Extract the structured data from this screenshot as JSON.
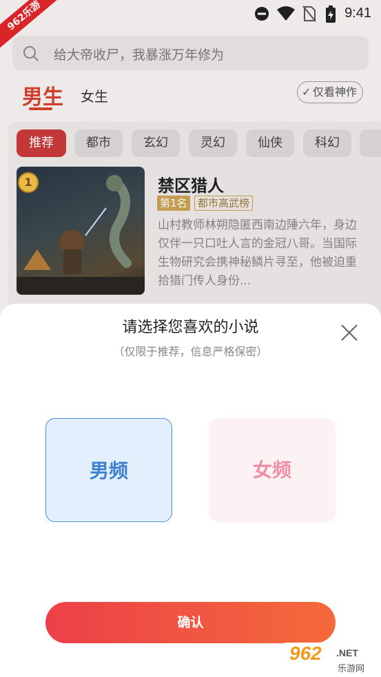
{
  "status_bar": {
    "time": "9:41"
  },
  "corner_watermark": "962乐游",
  "search": {
    "placeholder": "给大帝收尸，我暴涨万年修为"
  },
  "gender_tabs": {
    "male": "男生",
    "female": "女生",
    "only_good_label": "仅看神作"
  },
  "categories": [
    "推荐",
    "都市",
    "玄幻",
    "灵幻",
    "仙侠",
    "科幻"
  ],
  "book": {
    "title": "禁区猎人",
    "rank_number": "1",
    "rank_tag": "第1名",
    "list_tag": "都市高武榜",
    "description": "山村教师林朔隐匿西南边陲六年，身边仅伴一只口吐人言的金冠八哥。当国际生物研究会携神秘鳞片寻至，他被迫重拾猎门传人身份..."
  },
  "sheet": {
    "title": "请选择您喜欢的小说",
    "subtitle": "（仅限于推荐，信息严格保密）",
    "male_option": "男频",
    "female_option": "女频",
    "confirm_label": "确认"
  },
  "bottom_watermark": {
    "number": "962",
    "net": ".NET",
    "sub": "乐游网"
  },
  "colors": {
    "accent": "#d7402f",
    "male_blue": "#3b7fd0",
    "female_pink": "#f08fa3",
    "confirm_start": "#ec4049",
    "confirm_end": "#f46a3a"
  }
}
